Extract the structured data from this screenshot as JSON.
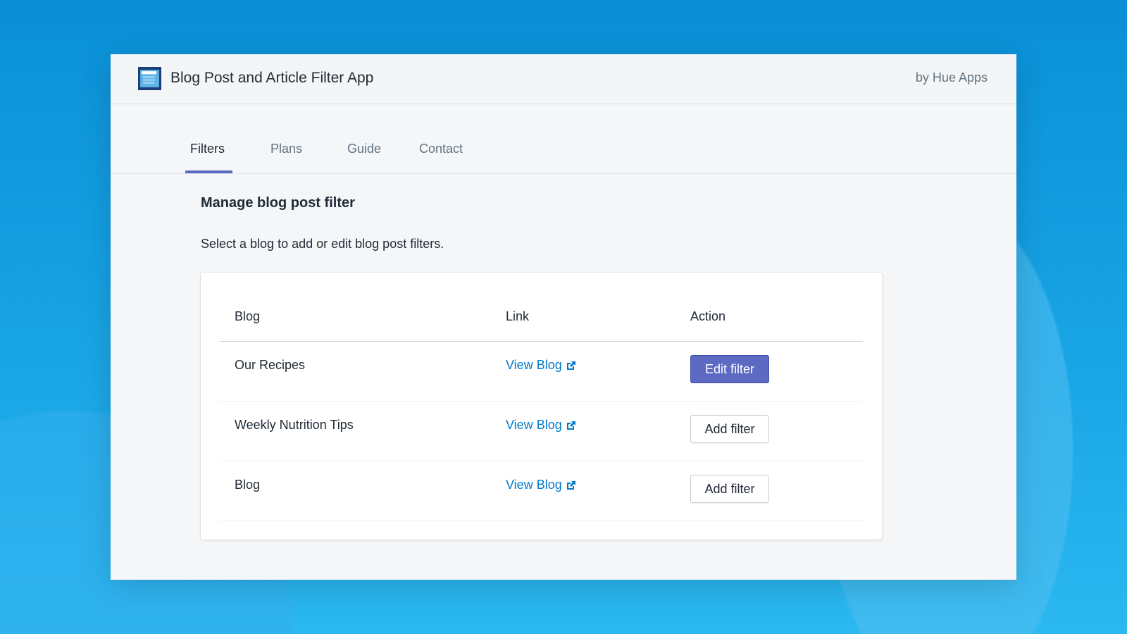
{
  "header": {
    "title": "Blog Post and Article Filter App",
    "byline": "by Hue Apps",
    "logo_icon": "list-filter-icon"
  },
  "tabs": [
    {
      "label": "Filters",
      "active": true
    },
    {
      "label": "Plans"
    },
    {
      "label": "Guide"
    },
    {
      "label": "Contact"
    }
  ],
  "main": {
    "heading": "Manage blog post filter",
    "intro": "Select a blog to add or edit blog post filters.",
    "table": {
      "headers": [
        "Blog",
        "Link",
        "Action"
      ],
      "rows": [
        {
          "blog": "Our Recipes",
          "link": "View Blog",
          "action": "Edit filter"
        },
        {
          "blog": "Weekly Nutrition Tips",
          "link": "View Blog",
          "action": "Add filter"
        },
        {
          "blog": "Blog",
          "link": "View Blog",
          "action": "Add filter"
        }
      ]
    }
  },
  "colors": {
    "accent": "#5c6ac4",
    "link": "#007ace",
    "background": "#0a8fd6"
  }
}
